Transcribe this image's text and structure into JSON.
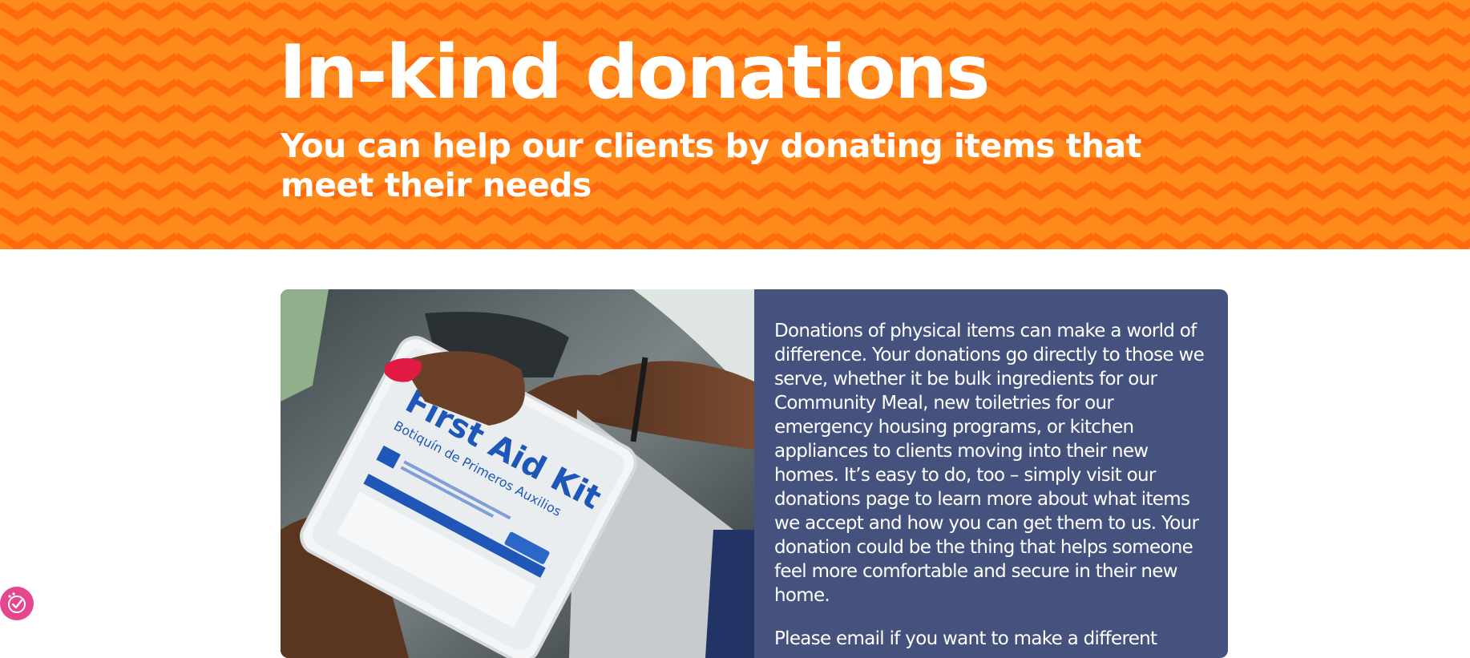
{
  "hero": {
    "title": "In-kind donations",
    "subtitle": "You can help our clients by donating items that meet their needs",
    "background_color": "#ff8a1c",
    "pattern_color": "#ff6a0f"
  },
  "card": {
    "image": {
      "icon": "first-aid-kit-photo",
      "kit_title": "First Aid Kit",
      "kit_subtitle": "Botiquín de Primeros Auxilios"
    },
    "paragraphs": [
      "Donations of physical items can make a world of difference. Your donations go directly to those we serve, whether it be bulk ingredients for our Community Meal, new toiletries for our emergency housing programs, or kitchen appliances to clients moving into their new homes. It’s easy to do, too – simply visit our donations page to learn more about what items we accept and how you can get them to us. Your donation could be the thing that helps someone feel more comfortable and secure in their new home.",
      "Please email if you want to make a different"
    ],
    "panel_color": "#45527e"
  },
  "accessibility_widget": {
    "icon": "accessibility-check-icon",
    "color": "#e5468e"
  }
}
